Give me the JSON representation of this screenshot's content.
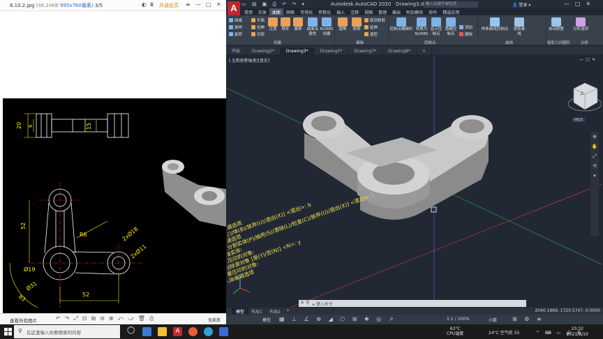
{
  "viewer": {
    "filename": "8.10.2.jpg",
    "filesize": "(48.24KB",
    "dims": "995x760像素)",
    "page": "3/5",
    "open_label": "开通会员",
    "bottom_label": "查看所有图片",
    "bottom_right": "无损放"
  },
  "drawing": {
    "dims": [
      "20",
      "6",
      "15",
      "52",
      "R6",
      "2xØ18",
      "2xØ11",
      "Ø19",
      "Ø31",
      "83",
      "52"
    ]
  },
  "acad": {
    "title": "Autodesk AutoCAD 2020",
    "docname": "Drawing3.dwg",
    "search_placeholder": "键入关键字或短语",
    "user": "登录",
    "logo": "A",
    "ribbon_tabs": [
      "常用",
      "实体",
      "曲面",
      "网格",
      "可视化",
      "参数化",
      "插入",
      "注释",
      "视图",
      "管理",
      "输出",
      "附加模块",
      "协作",
      "精选应用"
    ],
    "ribbon": {
      "small_left": [
        "网格",
        "平面",
        "放样",
        "拉伸",
        "旋转",
        "扫掠"
      ],
      "big": [
        "过渡",
        "修补",
        "偏移",
        "圆角",
        "修剪",
        "延伸"
      ],
      "surface_assoc": "曲面关联性",
      "nurbs": "NURBS创建",
      "edit_small": [
        "取消修剪",
        "延伸",
        "造型"
      ],
      "cv_editbar": "控制点编辑栏",
      "to_nurbs": "转换为NURBS",
      "show_cv": "显示控制点",
      "hide_cv": "隐藏控制点",
      "add": "添加",
      "remove": "删除",
      "spline_cv": "样条曲线控制点",
      "extract": "提取素线",
      "auto": "自动修整",
      "analysis": "分析选项",
      "panels": [
        "创建",
        "编辑",
        "控制点",
        "曲线",
        "投影几何图形",
        "分析"
      ]
    },
    "doc_tabs": [
      "开始",
      "Drawing2*",
      "Drawing3*",
      "Drawing5*",
      "Drawing7*",
      "Drawing8*"
    ],
    "viewport_label": "[-][西南等轴测][真实]",
    "viewcube_label": "上",
    "viewcube_sub": "WCS",
    "cmd_history": [
      "输入实体编辑选项",
      "[面(F)/边(E)/体(B)/放弃(U)/退出(X)] <退出>: b",
      "输入体编辑选项",
      "[压印(I)/分割实体(P)/抽壳(S)/清除(L)/检查(C)/放弃(U)/退出(X)] <退出>: i",
      "选择三维实体:",
      "选择要压印的对象:",
      "是否删除源对象 [是(Y)/否(N)] <N>: y",
      "选择要压印的对象:",
      "输入体编辑选项"
    ],
    "cmd_prompt": "键入命令",
    "layout_tabs": [
      "模型",
      "布局1",
      "布局2"
    ],
    "coords": "2040.1669, 1720.5747, 0.0000",
    "status_model": "模型",
    "status_scale": "1:1 / 100%",
    "status_decimal": "小数",
    "temp": "63°C",
    "temp_label": "CPU温度",
    "weather": "24°C 空气优 55",
    "time": "23:32",
    "date": "2021/8/10"
  },
  "taskbar": {
    "search_placeholder": "在这里输入你要搜索的内容"
  }
}
